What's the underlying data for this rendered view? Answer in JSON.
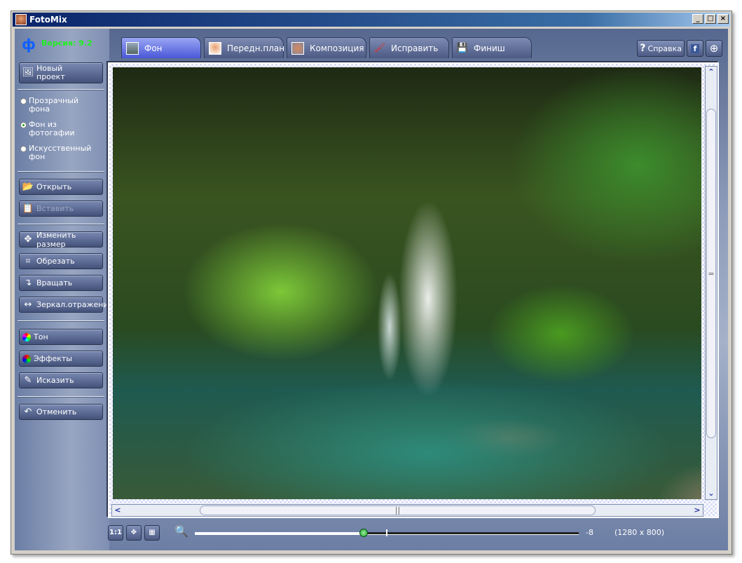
{
  "window": {
    "title": "FotoMix",
    "minimize": "_",
    "maximize": "□",
    "close": "×"
  },
  "left": {
    "logo": "ф",
    "version": "Версия: 9.2",
    "new_project": "Новый проект",
    "radios": [
      {
        "label": "Прозрачный фона",
        "selected": false
      },
      {
        "label": "Фон из фотогафии",
        "selected": true
      },
      {
        "label": "Искусственный фон",
        "selected": false
      }
    ],
    "open": "Открыть",
    "paste": "Вставить",
    "resize": "Изменить размер",
    "crop": "Обрезать",
    "rotate": "Вращать",
    "mirror": "Зеркал.отражение",
    "tone": "Тон",
    "effects": "Эффекты",
    "distort": "Исказить",
    "undo": "Отменить"
  },
  "tabs": [
    {
      "label": "Фон",
      "active": true
    },
    {
      "label": "Передн.план"
    },
    {
      "label": "Композиция"
    },
    {
      "label": "Исправить"
    },
    {
      "label": "Финиш"
    }
  ],
  "help": {
    "label": "Справка",
    "help_icon": "?",
    "facebook": "f",
    "web": "⊕"
  },
  "bottom": {
    "actual_size": "1:1",
    "fit": "✥",
    "grid": "▦",
    "zoom_value": "-8",
    "zoom_percent": 44,
    "dimensions": "(1280 x 800)"
  },
  "scroll": {
    "up": "⌃",
    "down": "⌄",
    "left": "<",
    "right": ">",
    "grip_v": "=",
    "grip_h": "||"
  }
}
